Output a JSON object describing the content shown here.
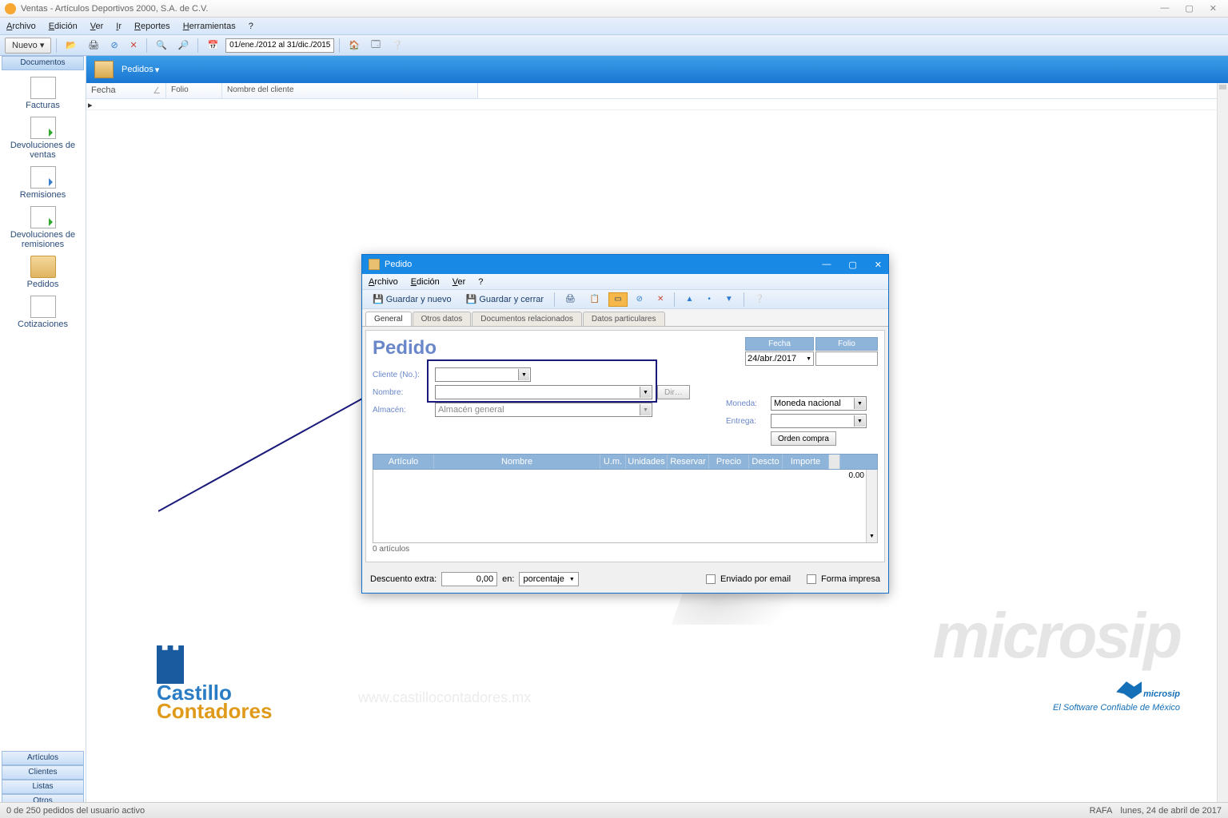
{
  "window": {
    "title": "Ventas - Artículos Deportivos 2000, S.A. de C.V.",
    "controls": {
      "min": "—",
      "max": "▢",
      "close": "✕"
    }
  },
  "menu": {
    "archivo": "Archivo",
    "edicion": "Edición",
    "ver": "Ver",
    "ir": "Ir",
    "reportes": "Reportes",
    "herramientas": "Herramientas",
    "help": "?"
  },
  "toolbar": {
    "nuevo": "Nuevo ▾",
    "date_range": "01/ene./2012 al 31/dic./2015"
  },
  "sidebar": {
    "top_tab": "Documentos",
    "items": [
      {
        "label": "Facturas"
      },
      {
        "label": "Devoluciones de ventas"
      },
      {
        "label": "Remisiones"
      },
      {
        "label": "Devoluciones de remisiones"
      },
      {
        "label": "Pedidos"
      },
      {
        "label": "Cotizaciones"
      }
    ],
    "bottom": [
      "Artículos",
      "Clientes",
      "Listas",
      "Otros"
    ]
  },
  "section": {
    "title": "Pedidos"
  },
  "grid": {
    "cols": [
      "Fecha",
      "Folio",
      "Nombre del cliente"
    ]
  },
  "dialog": {
    "title": "Pedido",
    "menu": {
      "archivo": "Archivo",
      "edicion": "Edición",
      "ver": "Ver",
      "help": "?"
    },
    "tb": {
      "guardar_nuevo": "Guardar y nuevo",
      "guardar_cerrar": "Guardar y cerrar"
    },
    "tabs": [
      "General",
      "Otros datos",
      "Documentos relacionados",
      "Datos particulares"
    ],
    "heading": "Pedido",
    "labels": {
      "cliente": "Cliente (No.):",
      "nombre": "Nombre:",
      "almacen": "Almacén:",
      "moneda": "Moneda:",
      "entrega": "Entrega:",
      "dir": "Dir…",
      "orden": "Orden compra",
      "fecha": "Fecha",
      "folio": "Folio"
    },
    "values": {
      "fecha": "24/abr./2017",
      "moneda": "Moneda nacional",
      "almacen": "Almacén general",
      "folio": ""
    },
    "cols": [
      "Artículo",
      "Nombre",
      "U.m.",
      "Unidades",
      "Reservar",
      "Precio",
      "Descto",
      "Importe"
    ],
    "total_row": "0.00",
    "items_footer": "0 artículos",
    "footer": {
      "descuento_lbl": "Descuento extra:",
      "descuento_val": "0,00",
      "en": "en:",
      "unidad": "porcentaje",
      "email": "Enviado por email",
      "impresa": "Forma impresa"
    }
  },
  "status": {
    "left": "0 de 250 pedidos del usuario activo",
    "user": "RAFA",
    "date": "lunes, 24 de abril de 2017"
  },
  "branding": {
    "watermark": "microsip",
    "castillo1": "Castillo",
    "castillo2": "Contadores",
    "url": "www.castillocontadores.mx",
    "ms": "microsip",
    "ms_tag": "El Software Confiable de México"
  }
}
